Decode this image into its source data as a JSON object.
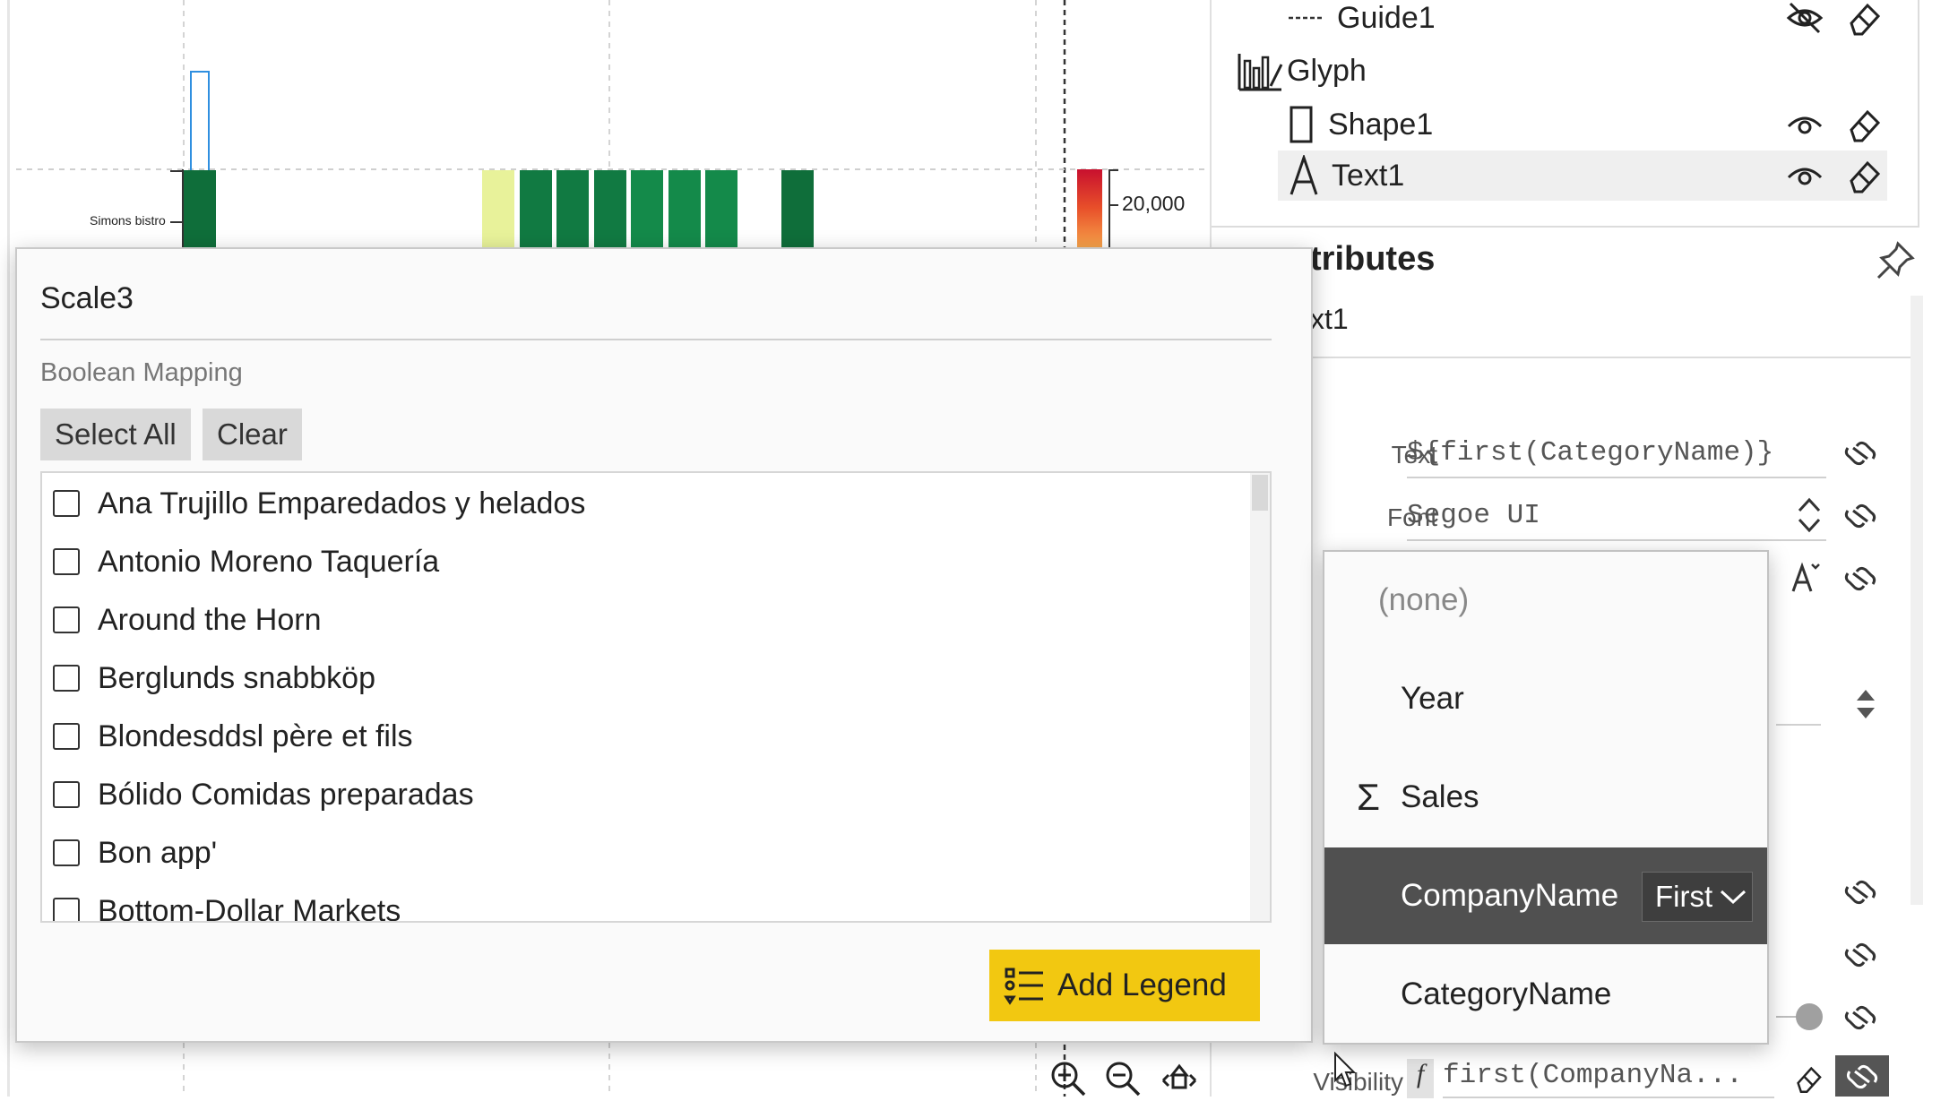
{
  "chart": {
    "row_label": "Simons bistro",
    "legend_value": "20,000",
    "bars": [
      {
        "color": "#0f6e3a"
      },
      {
        "color": "#e8f29a"
      },
      {
        "color": "#117a42"
      },
      {
        "color": "#117a42"
      },
      {
        "color": "#117a42"
      },
      {
        "color": "#148a4a"
      },
      {
        "color": "#148a4a"
      },
      {
        "color": "#148a4a"
      },
      {
        "color": "#0f6e3a"
      }
    ]
  },
  "layers": {
    "guide": "Guide1",
    "glyph": "Glyph",
    "shape": "Shape1",
    "text": "Text1"
  },
  "attributes": {
    "title_partial": "tributes",
    "subtitle_partial": "xt1",
    "text_label": "Text",
    "text_value": "${first(CategoryName)}",
    "font_label": "Font",
    "font_value": "Segoe UI",
    "visibility_label": "Visibility",
    "visibility_prefix": "f",
    "visibility_value": "first(CompanyNa..."
  },
  "scale_popup": {
    "title": "Scale3",
    "mapping_label": "Boolean Mapping",
    "select_all": "Select All",
    "clear": "Clear",
    "items": [
      "Ana Trujillo Emparedados y helados",
      "Antonio Moreno Taquería",
      "Around the Horn",
      "Berglunds snabbköp",
      "Blondesddsl père et fils",
      "Bólido Comidas preparadas",
      "Bon app'",
      "Bottom-Dollar Markets"
    ],
    "add_legend": "Add Legend"
  },
  "field_menu": {
    "none": "(none)",
    "year": "Year",
    "sales_symbol": "Σ",
    "sales": "Sales",
    "company": "CompanyName",
    "aggregation": "First",
    "category": "CategoryName"
  },
  "colors": {
    "accent": "#f2c811",
    "menu_active": "#505050",
    "bar_green": "#117a42"
  }
}
